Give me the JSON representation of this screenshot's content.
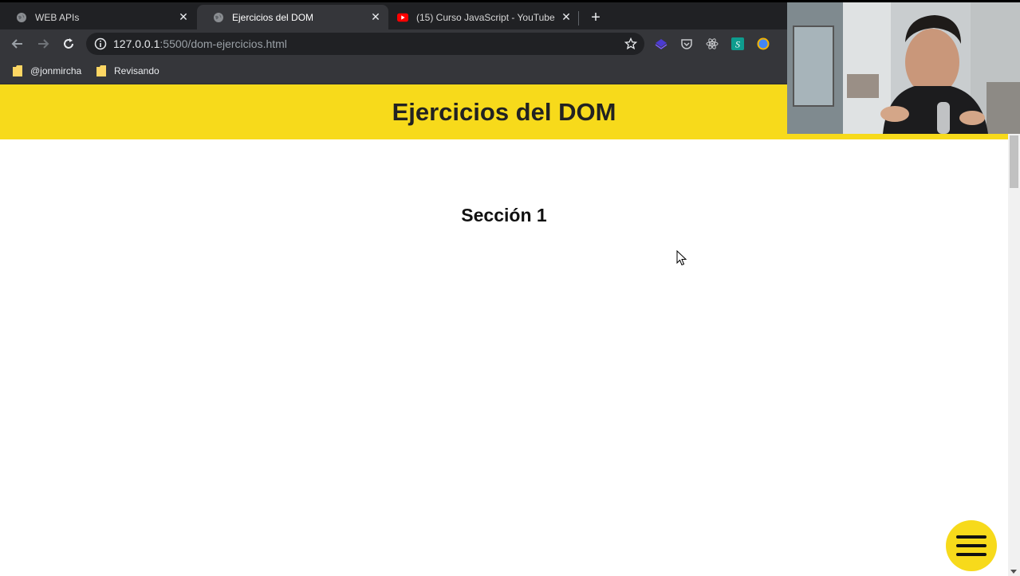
{
  "browser": {
    "tabs": [
      {
        "title": "WEB APIs",
        "active": false,
        "icon": "globe-icon"
      },
      {
        "title": "Ejercicios del DOM",
        "active": true,
        "icon": "globe-icon"
      },
      {
        "title": "(15) Curso JavaScript - YouTube",
        "active": false,
        "icon": "youtube-icon"
      }
    ],
    "address": {
      "host": "127.0.0.1",
      "rest": ":5500/dom-ejercicios.html"
    },
    "bookmarks": [
      {
        "label": "@jonmircha",
        "icon": "folder-icon"
      },
      {
        "label": "Revisando",
        "icon": "folder-icon"
      }
    ],
    "extensions": [
      "stack-extension-icon",
      "pocket-icon",
      "react-devtools-icon",
      "s-extension-icon",
      "compass-extension-icon"
    ]
  },
  "page": {
    "header_title": "Ejercicios del DOM",
    "section_title": "Sección 1"
  },
  "colors": {
    "accent_yellow": "#f7da1b",
    "chrome_dark": "#202124",
    "chrome_toolbar": "#35363a"
  }
}
